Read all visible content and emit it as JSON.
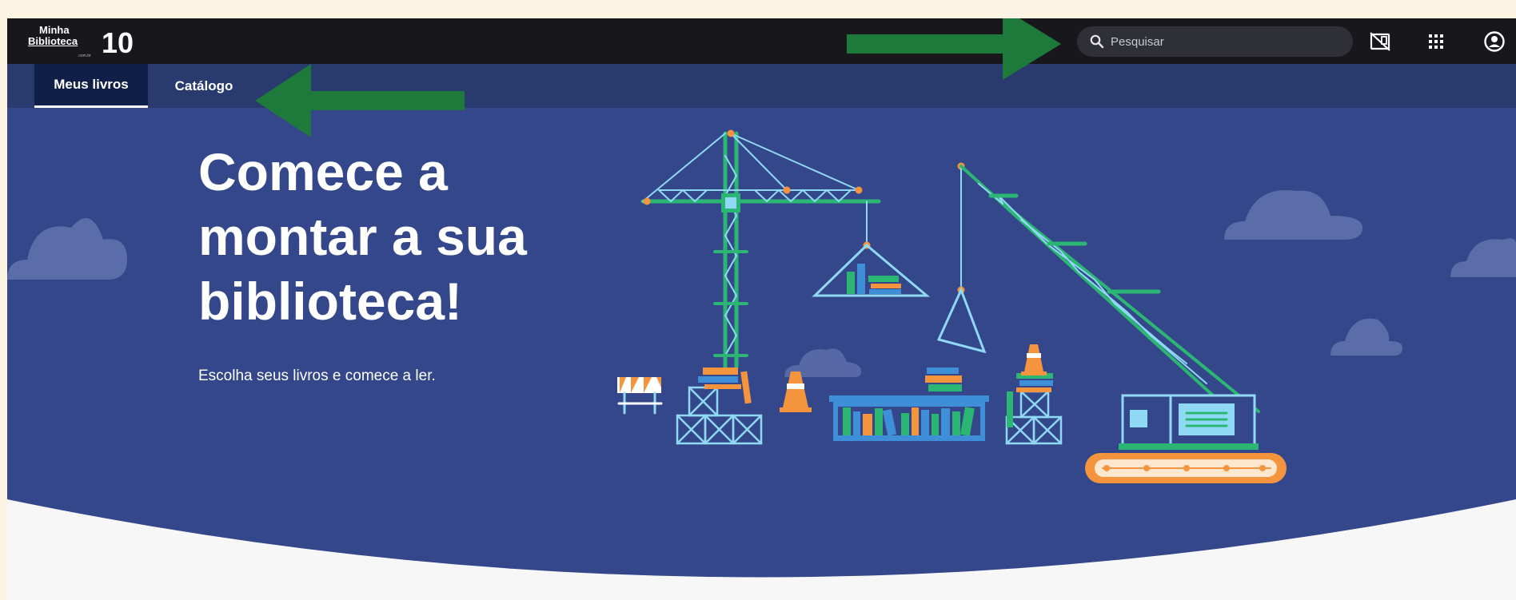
{
  "brand": {
    "logo_line1": "Minha",
    "logo_line2": "Biblioteca",
    "logo_sub": ".com.br",
    "logo_number": "10"
  },
  "header": {
    "search_placeholder": "Pesquisar",
    "icons": [
      "search-icon",
      "no-screen-icon",
      "apps-grid-icon",
      "account-icon"
    ]
  },
  "nav": {
    "tabs": [
      {
        "label": "Meus livros",
        "active": true
      },
      {
        "label": "Catálogo",
        "active": false
      }
    ]
  },
  "hero": {
    "title": "Comece a montar a sua biblioteca!",
    "subtitle": "Escolha seus livros e comece a ler."
  },
  "colors": {
    "topbar": "#17171c",
    "navbar": "#283a6e",
    "hero": "#34478a",
    "accent_green": "#2bb673",
    "arrow_green": "#1e7a3b",
    "orange": "#f4953d"
  }
}
